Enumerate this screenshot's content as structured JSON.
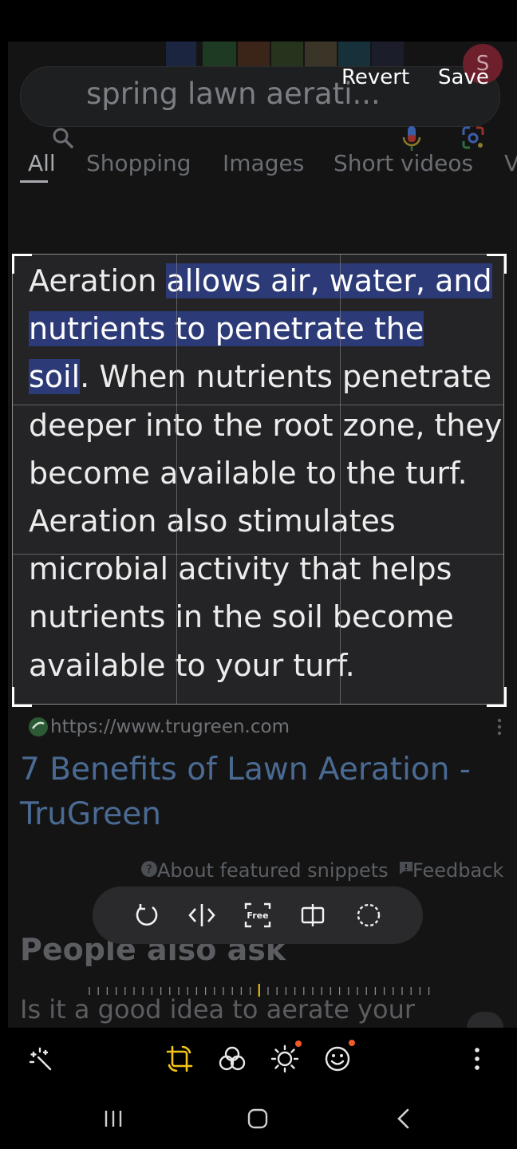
{
  "header": {
    "revert_label": "Revert",
    "save_label": "Save",
    "avatar_initial": "S"
  },
  "background_page": {
    "search_query": "spring lawn aerati...",
    "tabs": [
      "All",
      "Shopping",
      "Images",
      "Short videos",
      "V"
    ],
    "source_url": "https://www.trugreen.com",
    "result_title": "7 Benefits of Lawn Aeration - TruGreen",
    "snippet_about": "About featured snippets",
    "snippet_feedback": "Feedback",
    "people_also_ask": "People also ask",
    "question": "Is it a good idea to aerate your"
  },
  "snippet": {
    "lines": [
      [
        {
          "t": "Aeration ",
          "hl": false
        },
        {
          "t": "allows air, water, and",
          "hl": true
        }
      ],
      [
        {
          "t": "nutrients to penetrate the",
          "hl": true
        }
      ],
      [
        {
          "t": "soil",
          "hl": true
        },
        {
          "t": ". When nutrients penetrate",
          "hl": false
        }
      ],
      [
        {
          "t": "deeper into the root zone, they",
          "hl": false
        }
      ],
      [
        {
          "t": "become available to the turf.",
          "hl": false
        }
      ],
      [
        {
          "t": "Aeration also stimulates",
          "hl": false
        }
      ],
      [
        {
          "t": "microbial activity that helps",
          "hl": false
        }
      ],
      [
        {
          "t": "nutrients in the soil become",
          "hl": false
        }
      ],
      [
        {
          "t": "available to your turf.",
          "hl": false
        }
      ]
    ]
  },
  "crop_tools": [
    "rotate-icon",
    "flip-icon",
    "free-aspect-icon",
    "split-icon",
    "lasso-select-icon"
  ],
  "crop_tools_free_label": "Free",
  "editor_toolbar": [
    "auto-enhance-icon",
    "crop-rotate-icon",
    "filters-icon",
    "brightness-icon",
    "stickers-icon",
    "more-icon"
  ],
  "nav": [
    "recent-apps-icon",
    "home-icon",
    "back-icon"
  ],
  "colors": {
    "accent_active": "#f5c518",
    "highlight": "#2c3a78",
    "notification_dot": "#f05a2a"
  }
}
